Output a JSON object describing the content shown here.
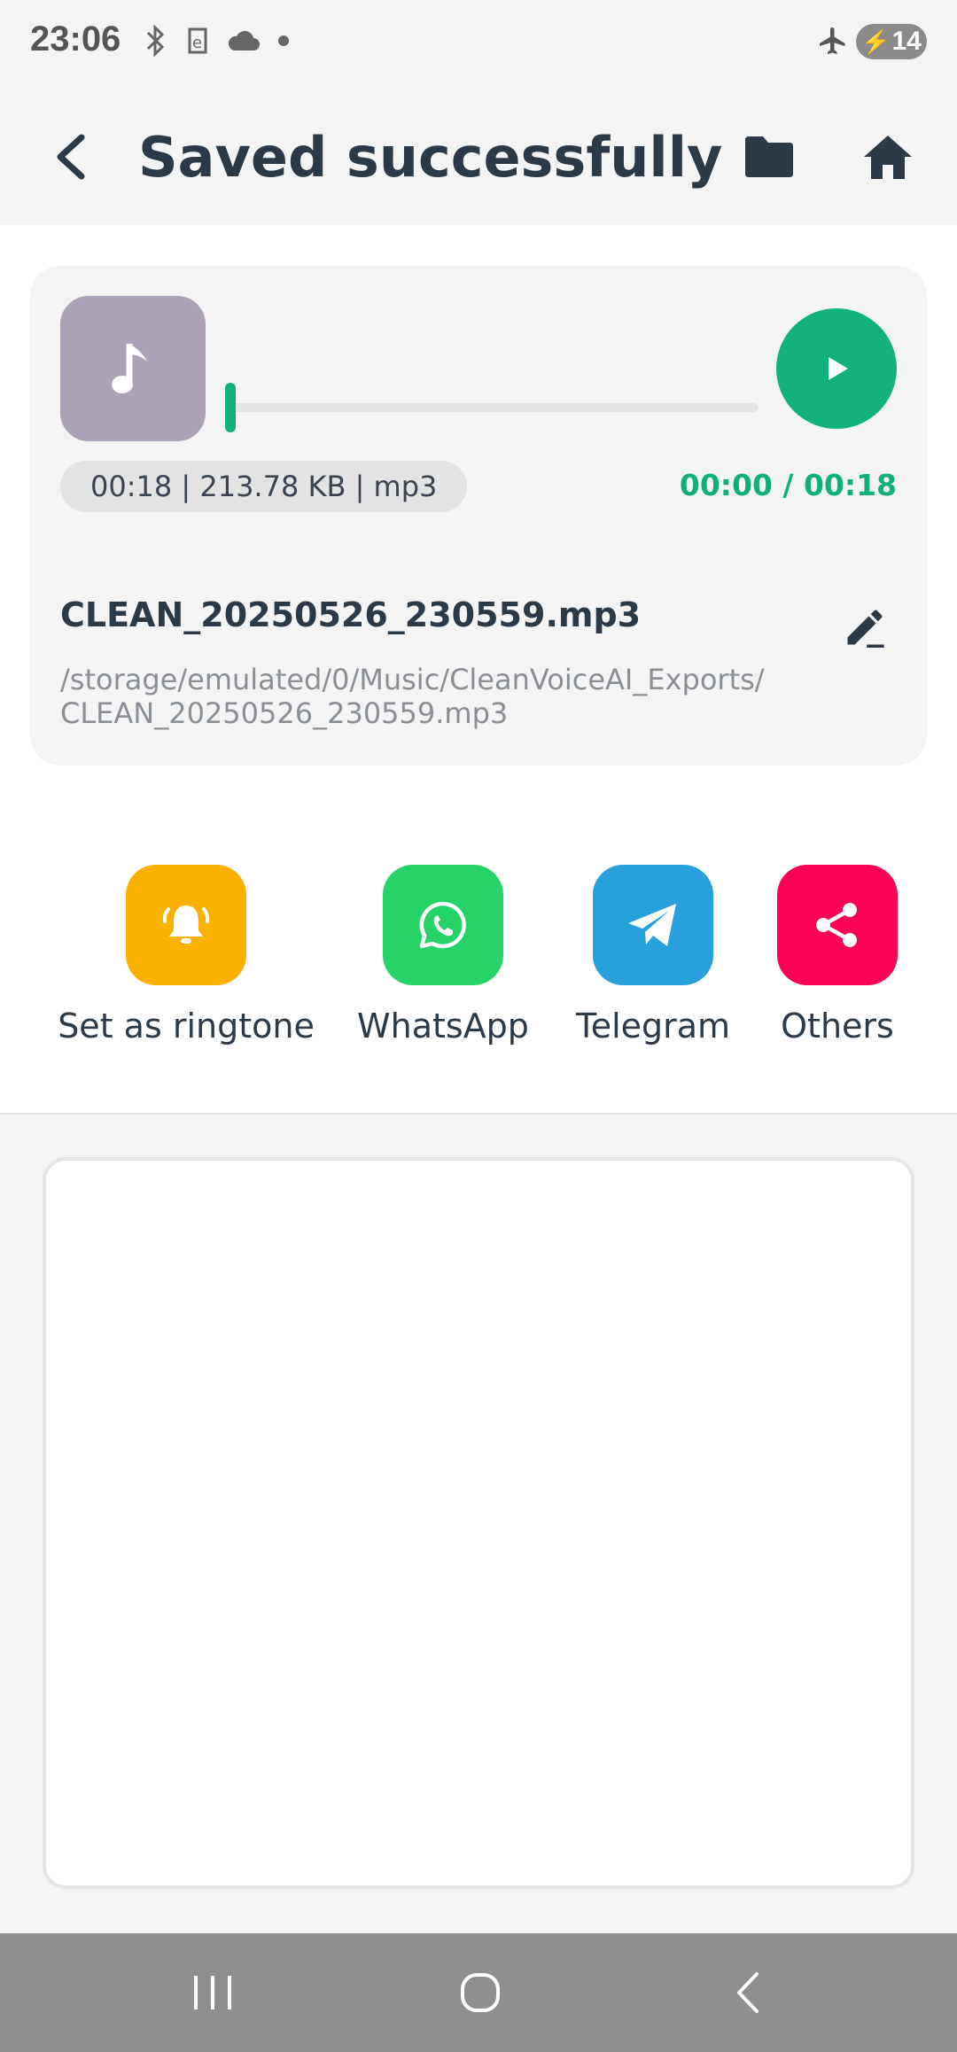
{
  "status_bar": {
    "time": "23:06",
    "icons": [
      "bluetooth-icon",
      "app-e-icon",
      "cloud-icon",
      "dot-icon",
      "airplane-icon"
    ],
    "battery_level": "14",
    "battery_charging": true
  },
  "app_bar": {
    "title": "Saved successfully",
    "back_icon": "back-arrow-icon",
    "folder_icon": "folder-icon",
    "home_icon": "home-icon"
  },
  "player": {
    "thumbnail_icon": "music-note-icon",
    "meta": "00:18 | 213.78 KB | mp3",
    "time_readout": "00:00 / 00:18",
    "progress": 0,
    "play_icon": "play-icon",
    "file_name": "CLEAN_20250526_230559.mp3",
    "edit_icon": "edit-pencil-icon",
    "file_path": "/storage/emulated/0/Music/CleanVoiceAI_Exports/\nCLEAN_20250526_230559.mp3"
  },
  "share_actions": [
    {
      "label": "Set as ringtone",
      "icon": "bell-icon",
      "color": "#fbb101"
    },
    {
      "label": "WhatsApp",
      "icon": "whatsapp-icon",
      "color": "#25d366"
    },
    {
      "label": "Telegram",
      "icon": "telegram-icon",
      "color": "#27a0dc"
    },
    {
      "label": "Others",
      "icon": "share-icon",
      "color": "#fc0058"
    }
  ],
  "colors": {
    "accent": "#12b27d",
    "title": "#2c3a47",
    "background": "#f4f4f4",
    "nav_bar": "#8f8f8f"
  },
  "nav_bar": {
    "icons": [
      "recent-apps-icon",
      "home-circle-icon",
      "nav-back-icon"
    ]
  }
}
